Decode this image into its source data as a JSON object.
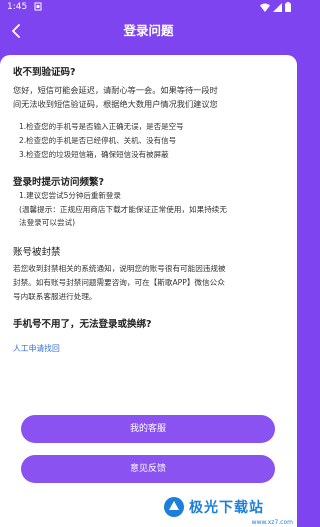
{
  "status_bar": {
    "time": "1:45",
    "icons": [
      "notification-icon",
      "wifi-icon",
      "signal-icon",
      "battery-icon"
    ]
  },
  "nav": {
    "title": "登录问题",
    "back_icon": "chevron-left-icon"
  },
  "section1": {
    "title": "收不到验证码?",
    "line1": "您好，短信可能会延迟，请耐心等一会。如果等待一段时",
    "line2": "间无法收到短信验证码，根据绝大数用户情况我们建议您",
    "items": [
      "1.检查您的手机号是否输入正确无误，是否是空号",
      "2.检查您的手机是否已经停机、关机、没有信号",
      "3.检查您的垃圾短信箱，确保短信没有被屏蔽"
    ]
  },
  "section2": {
    "title": "登录时提示访问频繁?",
    "item": "1.建议您尝试5分钟后重新登录",
    "note1": "(温馨提示：正规应用商店下载才能保证正常使用，如果持续无",
    "note2": "法登录可以尝试)"
  },
  "section3": {
    "title": "账号被封禁",
    "line1": "若您收到封禁相关的系统通知，说明您的账号很有可能因违规被",
    "line2": "封禁。如有账号封禁问题需要咨询，可在【斯歌APP】微信公众",
    "line3": "号内联系客服进行处理。"
  },
  "section4": {
    "title": "手机号不用了，无法登录或换绑?",
    "link": "人工申请找回"
  },
  "buttons": {
    "service": "我的客服",
    "feedback": "意见反馈"
  },
  "watermark": {
    "text": "极光下载站",
    "sub": "www.xz7.com"
  },
  "colors": {
    "accent": "#7d44f0",
    "button": "#8a52f0",
    "link": "#2f6fd6"
  }
}
